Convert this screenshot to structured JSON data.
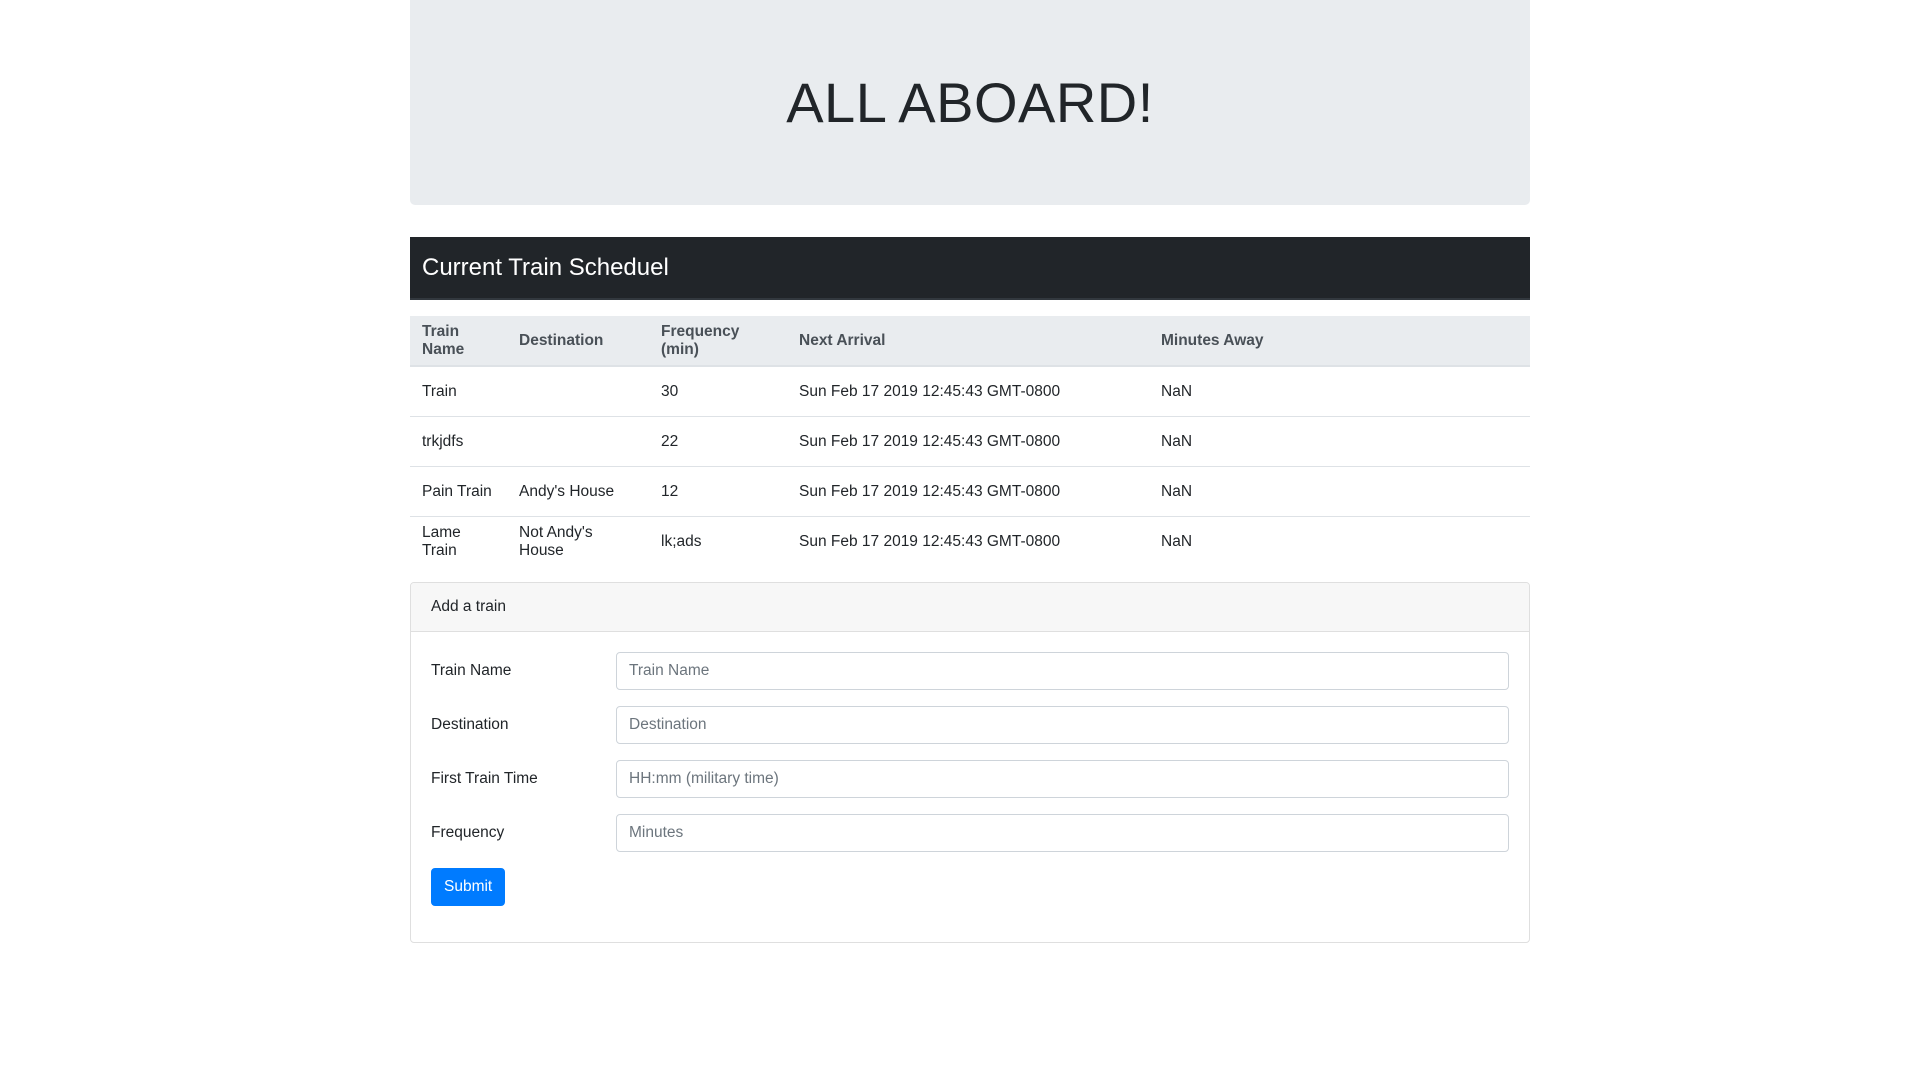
{
  "jumbotron": {
    "title": "ALL ABOARD!"
  },
  "schedule": {
    "heading": "Current Train Scheduel",
    "columns": [
      "Train Name",
      "Destination",
      "Frequency (min)",
      "Next Arrival",
      "Minutes Away"
    ],
    "rows": [
      [
        "Train",
        "",
        "30",
        "Sun Feb 17 2019 12:45:43 GMT-0800",
        "NaN"
      ],
      [
        "trkjdfs",
        "",
        "22",
        "Sun Feb 17 2019 12:45:43 GMT-0800",
        "NaN"
      ],
      [
        "Pain Train",
        "Andy's House",
        "12",
        "Sun Feb 17 2019 12:45:43 GMT-0800",
        "NaN"
      ],
      [
        "Lame Train",
        "Not Andy's House",
        "lk;ads",
        "Sun Feb 17 2019 12:45:43 GMT-0800",
        "NaN"
      ]
    ]
  },
  "form": {
    "header": "Add a train",
    "fields": [
      {
        "label": "Train Name",
        "placeholder": "Train Name",
        "value": ""
      },
      {
        "label": "Destination",
        "placeholder": "Destination",
        "value": ""
      },
      {
        "label": "First Train Time",
        "placeholder": "HH:mm (military time)",
        "value": ""
      },
      {
        "label": "Frequency",
        "placeholder": "Minutes",
        "value": ""
      }
    ],
    "submit_label": "Submit"
  }
}
